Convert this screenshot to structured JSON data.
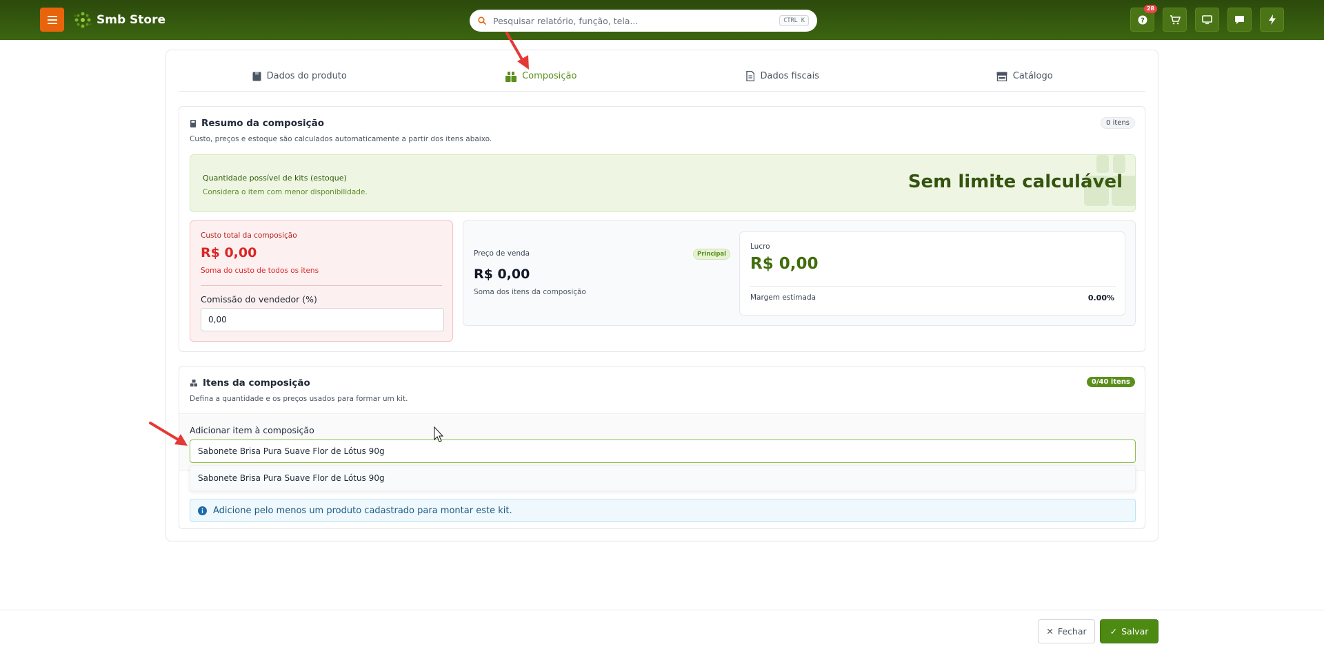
{
  "header": {
    "brand_name": "Smb Store",
    "search_placeholder": "Pesquisar relatório, função, tela...",
    "search_shortcut": "CTRL K",
    "notification_count": "28",
    "icons": [
      "help-icon",
      "cart-icon",
      "monitor-icon",
      "chat-icon",
      "bolt-icon"
    ]
  },
  "tabs": [
    {
      "label": "Dados do produto",
      "icon": "box-icon",
      "active": false
    },
    {
      "label": "Composição",
      "icon": "kit-icon",
      "active": true
    },
    {
      "label": "Dados fiscais",
      "icon": "document-icon",
      "active": false
    },
    {
      "label": "Catálogo",
      "icon": "store-icon",
      "active": false
    }
  ],
  "resumo": {
    "title": "Resumo da composição",
    "subtitle": "Custo, preços e estoque são calculados automaticamente a partir dos itens abaixo.",
    "count_badge": "0 itens",
    "kits_label": "Quantidade possível de kits (estoque)",
    "kits_hint": "Considera o item com menor disponibilidade.",
    "kits_value": "Sem limite calculável",
    "cost_label": "Custo total da composição",
    "cost_value": "R$ 0,00",
    "cost_hint": "Soma do custo de todos os itens",
    "commission_label": "Comissão do vendedor (%)",
    "commission_value": "0,00",
    "price_label": "Preço de venda",
    "principal_badge": "Principal",
    "price_value": "R$ 0,00",
    "price_hint": "Soma dos itens da composição",
    "profit_label": "Lucro",
    "profit_value": "R$ 0,00",
    "margin_label": "Margem estimada",
    "margin_value": "0.00%"
  },
  "itens": {
    "title": "Itens da composição",
    "subtitle": "Defina a quantidade e os preços usados para formar um kit.",
    "count_badge": "0/40 itens",
    "add_label": "Adicionar item à composição",
    "add_value": "Sabonete Brisa Pura Suave Flor de Lótus 90g",
    "suggestions": [
      "Sabonete Brisa Pura Suave Flor de Lótus 90g"
    ],
    "info_message": "Adicione pelo menos um produto cadastrado para montar este kit."
  },
  "footer": {
    "close_label": "Fechar",
    "save_label": "Salvar"
  },
  "colors": {
    "topbar": "#2c4a0c",
    "menu_button": "#e8640c",
    "accent_green": "#5a8f1c",
    "cost_red": "#dc2626",
    "profit_green": "#3f6d0c",
    "annotation_red": "#e53935"
  }
}
